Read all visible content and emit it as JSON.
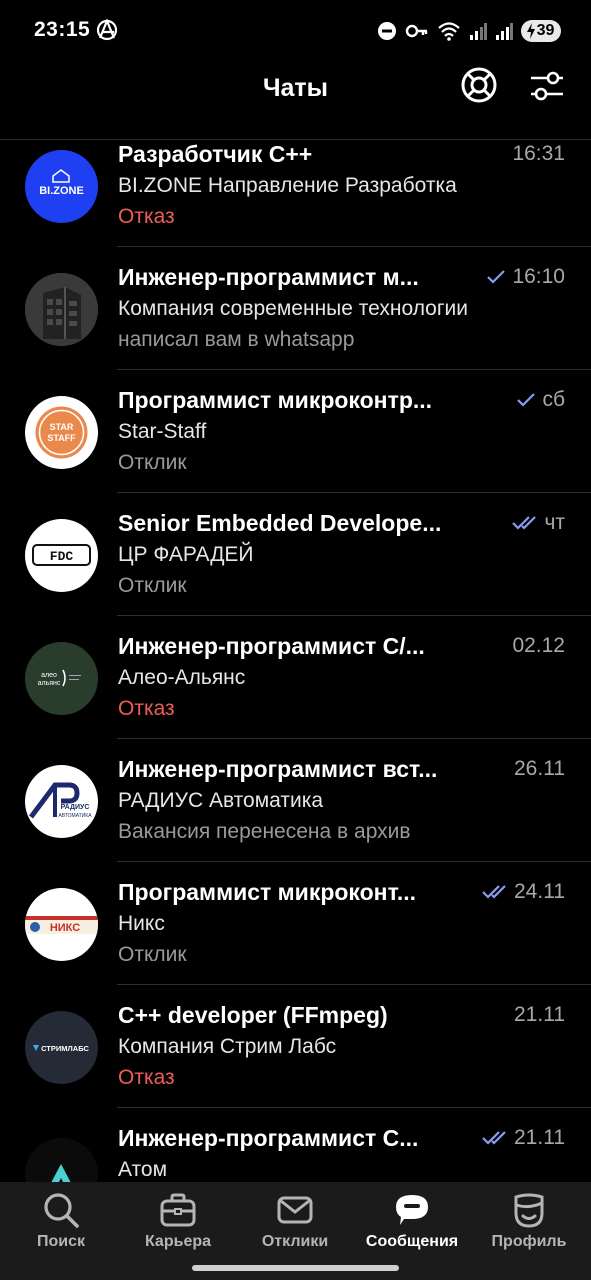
{
  "status_bar": {
    "time": "23:15",
    "battery": "39"
  },
  "header": {
    "title": "Чаты"
  },
  "chats": [
    {
      "title": "Разработчик С++",
      "time": "16:31",
      "read": "none",
      "subtitle": "BI.ZONE Направление Разработка",
      "status": "Отказ",
      "status_type": "reject",
      "avatar": {
        "text": "BI.ZONE",
        "bg": "#1e3ff2",
        "fg": "#ffffff"
      }
    },
    {
      "title": "Инженер-программист м...",
      "time": "16:10",
      "read": "single",
      "subtitle": "Компания современные технологии",
      "status": "написал вам в whatsapp",
      "status_type": "normal",
      "avatar": {
        "text": "",
        "bg": "#3a3a3a",
        "fg": "#ffffff"
      }
    },
    {
      "title": "Программист микроконтр...",
      "time": "сб",
      "read": "single",
      "subtitle": "Star-Staff",
      "status": "Отклик",
      "status_type": "normal",
      "avatar": {
        "text": "STAR STAFF",
        "bg": "#ffffff",
        "fg": "#e98a4c"
      }
    },
    {
      "title": "Senior Embedded Develope...",
      "time": "чт",
      "read": "double",
      "subtitle": "ЦР ФАРАДЕЙ",
      "status": "Отклик",
      "status_type": "normal",
      "avatar": {
        "text": "FDC",
        "bg": "#ffffff",
        "fg": "#111111"
      }
    },
    {
      "title": "Инженер-программист С/...",
      "time": "02.12",
      "read": "none",
      "subtitle": "Алео-Альянс",
      "status": "Отказ",
      "status_type": "reject",
      "avatar": {
        "text": "алео альянс",
        "bg": "#2a3d2c",
        "fg": "#ffffff"
      }
    },
    {
      "title": "Инженер-программист вст...",
      "time": "26.11",
      "read": "none",
      "subtitle": "РАДИУС Автоматика",
      "status": "Вакансия перенесена в архив",
      "status_type": "normal",
      "avatar": {
        "text": "РАДИУС",
        "bg": "#ffffff",
        "fg": "#1c2a6b"
      }
    },
    {
      "title": "Программист микроконт...",
      "time": "24.11",
      "read": "double",
      "subtitle": "Никс",
      "status": "Отклик",
      "status_type": "normal",
      "avatar": {
        "text": "НИКС",
        "bg": "#ffffff",
        "fg": "#c9302c"
      }
    },
    {
      "title": "C++ developer (FFmpeg)",
      "time": "21.11",
      "read": "none",
      "subtitle": "Компания Стрим Лабс",
      "status": "Отказ",
      "status_type": "reject",
      "avatar": {
        "text": "СТРИМЛАБС",
        "bg": "#242a36",
        "fg": "#ffffff"
      }
    },
    {
      "title": "Инженер-программист С...",
      "time": "21.11",
      "read": "double",
      "subtitle": "Атом",
      "status": "",
      "status_type": "normal",
      "avatar": {
        "text": "",
        "bg": "#0b0b0b",
        "fg": "#4fd0d0"
      }
    }
  ],
  "nav": [
    {
      "label": "Поиск",
      "icon": "search-icon",
      "active": false
    },
    {
      "label": "Карьера",
      "icon": "briefcase-icon",
      "active": false
    },
    {
      "label": "Отклики",
      "icon": "mail-icon",
      "active": false
    },
    {
      "label": "Сообщения",
      "icon": "chat-bubble-icon",
      "active": true
    },
    {
      "label": "Профиль",
      "icon": "profile-icon",
      "active": false
    }
  ],
  "colors": {
    "background": "#000000",
    "reject": "#f05c56",
    "check": "#8c9cf2",
    "nav_background": "#1b1b1b"
  }
}
